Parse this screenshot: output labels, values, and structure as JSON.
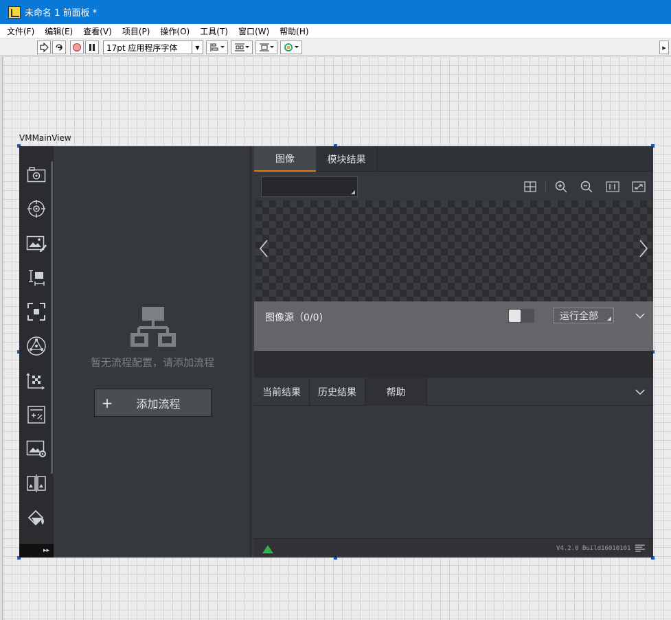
{
  "window": {
    "title": "未命名 1 前面板 *",
    "app_icon": "labview-vi-icon"
  },
  "menu": {
    "items": [
      "文件(F)",
      "编辑(E)",
      "查看(V)",
      "项目(P)",
      "操作(O)",
      "工具(T)",
      "窗口(W)",
      "帮助(H)"
    ]
  },
  "toolbar": {
    "font_selector": "17pt 应用程序字体",
    "icons": [
      "run-arrow-icon",
      "run-continuous-icon",
      "abort-icon",
      "pause-icon",
      "align-objects-icon",
      "distribute-objects-icon",
      "resize-objects-icon",
      "reorder-icon"
    ]
  },
  "vm": {
    "label": "VMMainView",
    "sidebar_icons": [
      "camera-icon",
      "target-icon",
      "image-edit-icon",
      "measure-icon",
      "focus-frame-icon",
      "polygon-node-icon",
      "calibration-icon",
      "calculator-icon",
      "image-settings-icon",
      "image-compare-icon",
      "paint-bucket-icon"
    ],
    "expand_glyph": "▸▸",
    "flow": {
      "empty_message": "暂无流程配置，请添加流程",
      "add_button_plus": "+",
      "add_button_label": "添加流程"
    },
    "image_tabs": [
      "图像",
      "模块结果"
    ],
    "image_tools": [
      "grid-icon",
      "zoom-in-icon",
      "zoom-out-icon",
      "one-to-one-icon",
      "fit-screen-icon"
    ],
    "image_source": {
      "label": "图像源（0/0)",
      "run_all": "运行全部"
    },
    "result_tabs": [
      "当前结果",
      "历史结果",
      "帮助"
    ],
    "status": {
      "version": "V4.2.0 Build16010101"
    },
    "colors": {
      "accent_tab_underline": "#e07a1f",
      "panel_bg": "#35383c",
      "sidebar_bg": "#2a2c2f",
      "status_ok": "#2fb34a"
    }
  }
}
